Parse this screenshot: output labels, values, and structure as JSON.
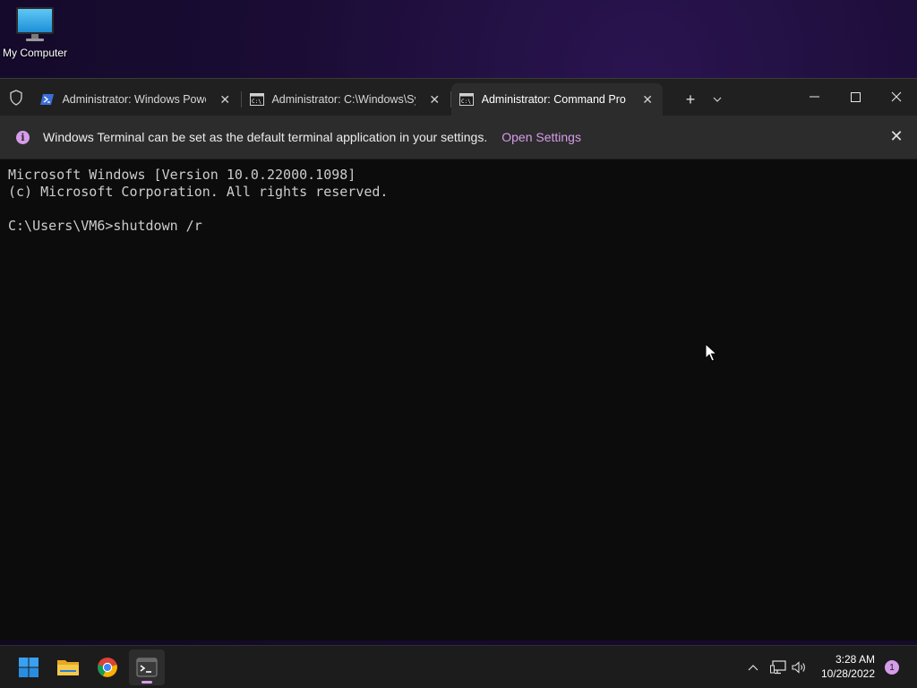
{
  "desktop": {
    "icons": [
      {
        "label": "My Computer",
        "icon": "monitor-icon"
      }
    ]
  },
  "terminal": {
    "tabs": [
      {
        "title": "Administrator: Windows Powe",
        "icon": "powershell-icon",
        "active": false
      },
      {
        "title": "Administrator:  C:\\Windows\\Sy",
        "icon": "cmd-icon",
        "active": false
      },
      {
        "title": "Administrator: Command Pro",
        "icon": "cmd-icon",
        "active": true
      }
    ],
    "new_tab_symbol": "+",
    "dropdown_symbol": "⌄",
    "window_controls": {
      "minimize": "—",
      "maximize": "☐",
      "close": "✕"
    },
    "infobar": {
      "message": "Windows Terminal can be set as the default terminal application in your settings.",
      "link": "Open Settings",
      "close": "✕",
      "accent": "#d69ce9"
    },
    "console_lines": [
      "Microsoft Windows [Version 10.0.22000.1098]",
      "(c) Microsoft Corporation. All rights reserved.",
      "",
      "C:\\Users\\VM6>shutdown /r"
    ]
  },
  "taskbar": {
    "pinned": [
      {
        "name": "start-button",
        "icon": "windows-logo-icon"
      },
      {
        "name": "file-explorer",
        "icon": "folder-icon"
      },
      {
        "name": "chrome",
        "icon": "chrome-icon"
      },
      {
        "name": "windows-terminal",
        "icon": "terminal-icon",
        "active": true
      }
    ],
    "tray_icons": [
      "chevron-up-icon",
      "network-icon",
      "volume-icon"
    ],
    "clock": {
      "time": "3:28 AM",
      "date": "10/28/2022"
    },
    "notification_count": "1"
  },
  "colors": {
    "accent": "#d69ce9",
    "terminal_bg": "#0c0c0c",
    "titlebar_bg": "#202020"
  }
}
